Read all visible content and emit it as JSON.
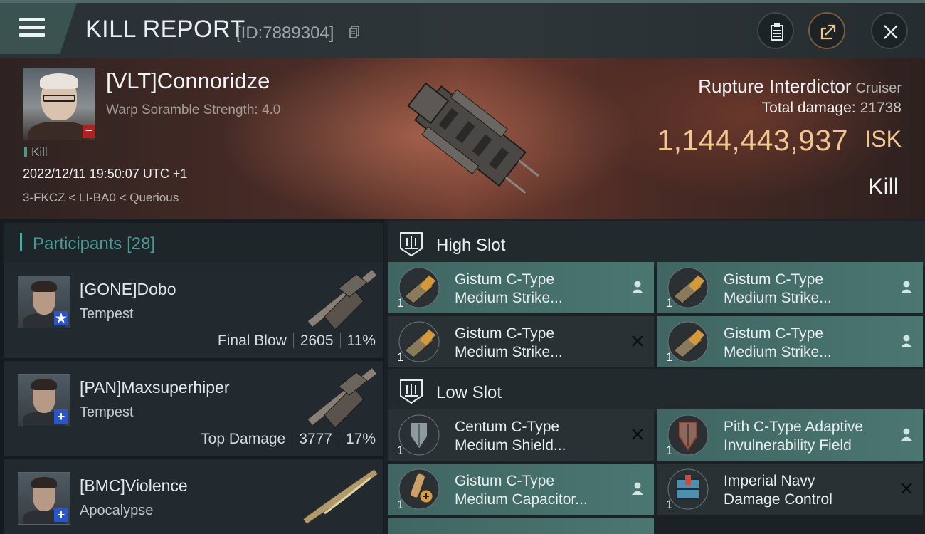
{
  "header": {
    "title": "KILL REPORT",
    "report_id": "[ID:7889304]"
  },
  "victim": {
    "name": "[VLT]Connoridze",
    "warp_scramble": "Warp Soramble Strength: 4.0",
    "tag": "Kill",
    "datetime": "2022/12/11 19:50:07 UTC +1",
    "location": "3-FKCZ < LI-BA0 < Querious",
    "ship_name": "Rupture Interdictor",
    "ship_class": "Cruiser",
    "total_damage_label": "Total damage:",
    "total_damage": "21738",
    "isk_value": "1,144,443,937",
    "isk_unit": "ISK",
    "result": "Kill"
  },
  "participants": {
    "title": "Participants",
    "count": "[28]",
    "rows": [
      {
        "name": "[GONE]Dobo",
        "ship": "Tempest",
        "role": "Final Blow",
        "damage": "2605",
        "percent": "11%",
        "badge": "★"
      },
      {
        "name": "[PAN]Maxsuperhiper",
        "ship": "Tempest",
        "role": "Top Damage",
        "damage": "3777",
        "percent": "17%",
        "badge": "+"
      },
      {
        "name": "[BMC]Violence",
        "ship": "Apocalypse",
        "badge": "+"
      }
    ]
  },
  "slots": {
    "high": {
      "title": "High Slot",
      "modules": [
        {
          "line1": "Gistum C-Type",
          "line2": "Medium Strike...",
          "qty": "1",
          "status": "person"
        },
        {
          "line1": "Gistum C-Type",
          "line2": "Medium Strike...",
          "qty": "1",
          "status": "person"
        },
        {
          "line1": "Gistum C-Type",
          "line2": "Medium Strike...",
          "qty": "1",
          "status": "destroyed"
        },
        {
          "line1": "Gistum C-Type",
          "line2": "Medium Strike...",
          "qty": "1",
          "status": "person"
        }
      ]
    },
    "low": {
      "title": "Low Slot",
      "modules": [
        {
          "line1": "Centum C-Type",
          "line2": "Medium Shield...",
          "qty": "1",
          "status": "destroyed"
        },
        {
          "line1": "Pith C-Type Adaptive",
          "line2": "Invulnerability Field",
          "qty": "1",
          "status": "person"
        },
        {
          "line1": "Gistum C-Type",
          "line2": "Medium Capacitor...",
          "qty": "1",
          "status": "person"
        },
        {
          "line1": "Imperial Navy",
          "line2": "Damage Control",
          "qty": "1",
          "status": "destroyed"
        }
      ]
    }
  },
  "colors": {
    "accent": "#4ba8a6",
    "isk": "#f2c690",
    "dropped_bg": "#4b7671",
    "destroyed_bg": "#2a3135"
  }
}
